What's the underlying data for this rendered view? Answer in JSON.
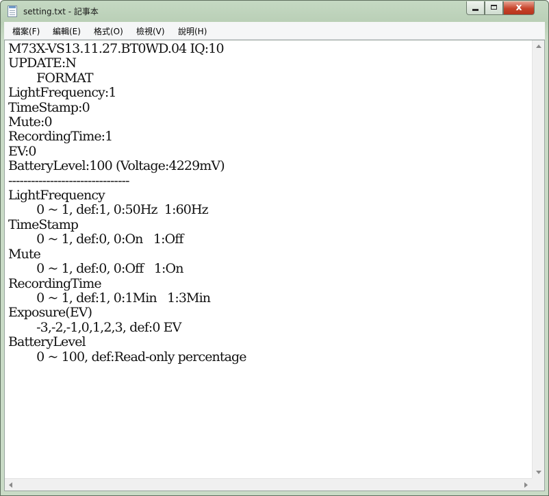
{
  "window": {
    "title": "setting.txt - 記事本"
  },
  "controls": {
    "close_label": "x"
  },
  "menubar": {
    "items": [
      {
        "label": "檔案(F)"
      },
      {
        "label": "編輯(E)"
      },
      {
        "label": "格式(O)"
      },
      {
        "label": "檢視(V)"
      },
      {
        "label": "說明(H)"
      }
    ]
  },
  "editor": {
    "lines": [
      "M73X-VS13.11.27.BT0WD.04 IQ:10",
      "UPDATE:N",
      "        FORMAT",
      "LightFrequency:1",
      "TimeStamp:0",
      "Mute:0",
      "RecordingTime:1",
      "EV:0",
      "BatteryLevel:100 (Voltage:4229mV)",
      "--------------------------------",
      "LightFrequency",
      "        0 ~ 1, def:1, 0:50Hz  1:60Hz",
      "TimeStamp",
      "        0 ~ 1, def:0, 0:On   1:Off",
      "Mute",
      "        0 ~ 1, def:0, 0:Off   1:On",
      "RecordingTime",
      "        0 ~ 1, def:1, 0:1Min   1:3Min",
      "Exposure(EV)",
      "        -3,-2,-1,0,1,2,3, def:0 EV",
      "BatteryLevel",
      "        0 ~ 100, def:Read-only percentage"
    ]
  },
  "icons": {
    "app": "notepad-icon",
    "minimize": "minimize-icon",
    "maximize": "maximize-icon",
    "close": "close-icon"
  }
}
